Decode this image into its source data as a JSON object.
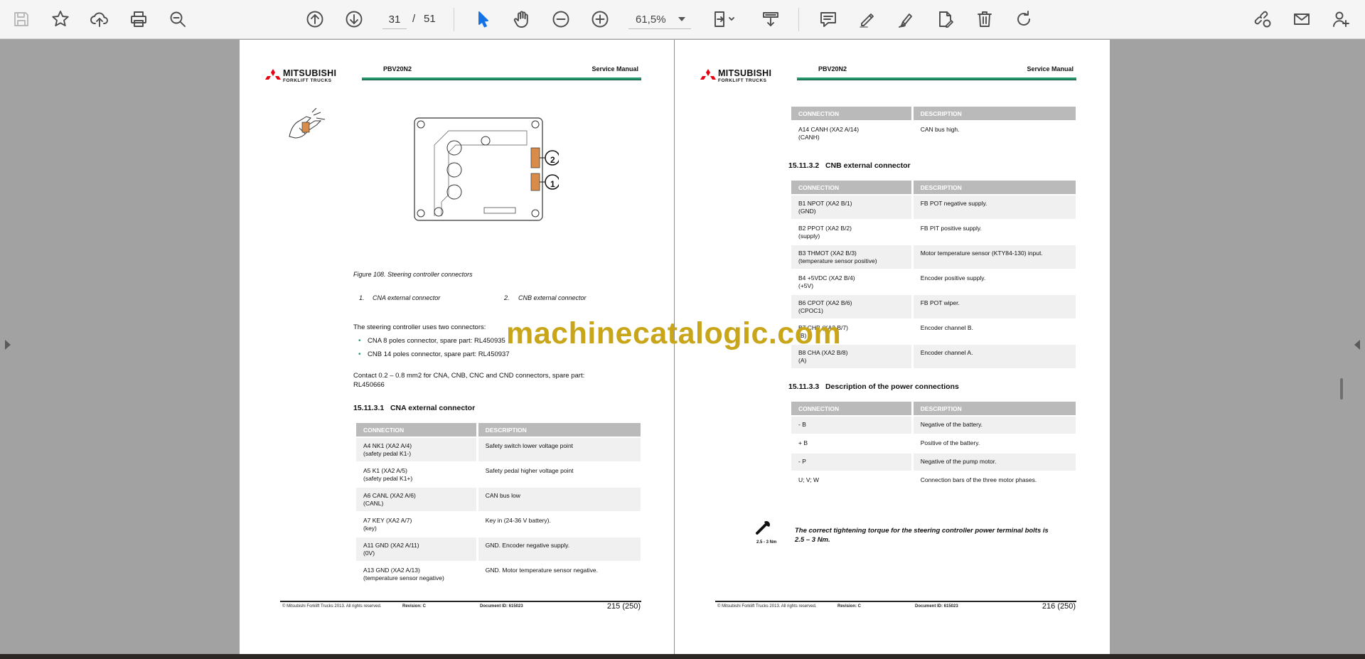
{
  "toolbar": {
    "page_current": "31",
    "page_separator": "/",
    "page_total": "51",
    "zoom": "61,5%"
  },
  "watermark": "machinecatalogic.com",
  "colors": {
    "accent_green": "#25986d",
    "watermark_gold": "#c9a51a",
    "logo_red": "#e60012",
    "connector_orange": "#d98c4a"
  },
  "left_page": {
    "header": {
      "brand": "MITSUBISHI",
      "brand_sub": "FORKLIFT TRUCKS",
      "model": "PBV20N2",
      "manual": "Service Manual"
    },
    "figure_callouts": [
      "2",
      "1"
    ],
    "figure_caption": "Figure 108. Steering controller connectors",
    "legend": [
      "1.",
      "CNA external connector",
      "2.",
      "CNB external connector"
    ],
    "intro": "The steering controller uses two connectors:",
    "bullets": [
      "CNA 8 poles connector, spare part: RL450935",
      "CNB 14 poles connector, spare part: RL450937"
    ],
    "contact_line1": "Contact 0.2 – 0.8 mm2 for CNA, CNB, CNC and CND connectors, spare part:",
    "contact_line2": "RL450666",
    "section_title": "15.11.3.1   CNA external connector",
    "table_header": [
      "CONNECTION",
      "DESCRIPTION"
    ],
    "table_rows": [
      [
        "A4 NK1 (XA2 A/4)",
        "(safety pedal K1-)",
        "Safety switch lower voltage point"
      ],
      [
        "A5 K1 (XA2 A/5)",
        "(safety pedal K1+)",
        "Safety pedal higher voltage point"
      ],
      [
        "A6 CANL (XA2 A/6)",
        "(CANL)",
        "CAN bus low"
      ],
      [
        "A7 KEY (XA2 A/7)",
        "(key)",
        "Key in (24-36 V battery)."
      ],
      [
        "A11 GND (XA2 A/11)",
        "(0V)",
        "GND. Encoder negative supply."
      ],
      [
        "A13 GND (XA2 A/13)",
        "(temperature sensor negative)",
        "GND. Motor temperature sensor negative."
      ]
    ],
    "footer": {
      "copyright": "© Mitsubishi Forklift Trucks 2013. All rights reserved.",
      "revision": "Revision: C",
      "document": "Document ID: 615023",
      "page": "215 (250)"
    }
  },
  "right_page": {
    "header": {
      "brand": "MITSUBISHI",
      "brand_sub": "FORKLIFT TRUCKS",
      "model": "PBV20N2",
      "manual": "Service Manual"
    },
    "table1_header": [
      "CONNECTION",
      "DESCRIPTION"
    ],
    "table1_rows": [
      [
        "A14 CANH (XA2 A/14)",
        "(CANH)",
        "CAN bus high."
      ]
    ],
    "section2_title": "15.11.3.2   CNB external connector",
    "table2_header": [
      "CONNECTION",
      "DESCRIPTION"
    ],
    "table2_rows": [
      [
        "B1 NPOT (XA2 B/1)",
        "(GND)",
        "FB POT negative supply."
      ],
      [
        "B2 PPOT (XA2 B/2)",
        "(supply)",
        "FB PIT positive supply."
      ],
      [
        "B3 THMOT (XA2 B/3)",
        "(temperature sensor positive)",
        "Motor temperature sensor (KTY84-130) input."
      ],
      [
        "B4 +5VDC (XA2 B/4)",
        "(+5V)",
        "Encoder positive supply."
      ],
      [
        "B6 CPOT (XA2 B/6)",
        "(CPOC1)",
        "FB POT wiper."
      ],
      [
        "B7 CHB (XA2 B/7)",
        "(B)",
        "Encoder channel B."
      ],
      [
        "B8 CHA (XA2 B/8)",
        "(A)",
        "Encoder channel A."
      ]
    ],
    "section3_title": "15.11.3.3   Description of the power connections",
    "table3_header": [
      "CONNECTION",
      "DESCRIPTION"
    ],
    "table3_rows": [
      [
        "- B",
        "Negative of the battery."
      ],
      [
        "+ B",
        "Positive of the battery."
      ],
      [
        "- P",
        "Negative of the pump motor."
      ],
      [
        "U; V; W",
        "Connection bars of the three motor phases."
      ]
    ],
    "torque_label": "2.5 - 3 Nm",
    "torque_note_line1": "The correct tightening torque for the steering controller power terminal bolts is",
    "torque_note_line2": "2.5 – 3 Nm.",
    "footer": {
      "copyright": "© Mitsubishi Forklift Trucks 2013. All rights reserved.",
      "revision": "Revision: C",
      "document": "Document ID: 615023",
      "page": "216 (250)"
    }
  }
}
